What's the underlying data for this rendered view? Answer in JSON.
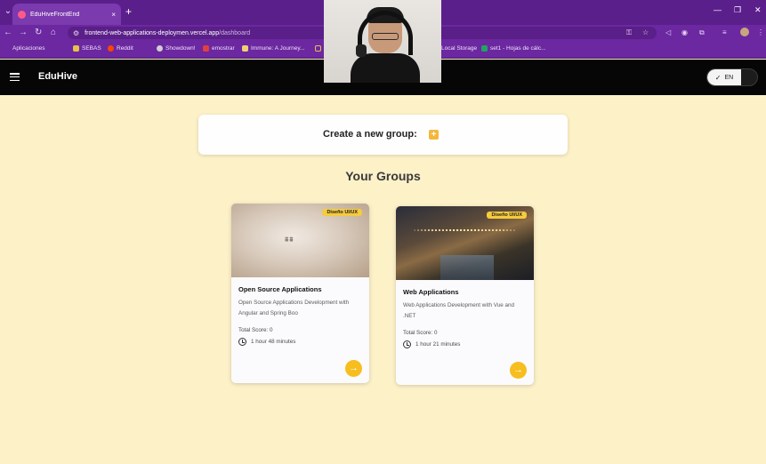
{
  "browser": {
    "tab_title": "EduHiveFrontEnd",
    "tab_close": "×",
    "new_tab": "+",
    "url_host": "frontend-web-applications-deploymen.vercel.app",
    "url_path": "/dashboard",
    "bookmarks": [
      {
        "label": "Aplicaciones",
        "color": "#7a7a7a"
      },
      {
        "label": "SEBAS",
        "color": "#e8c24a"
      },
      {
        "label": "Reddit",
        "color": "#ff4500"
      },
      {
        "label": "Showdown!",
        "color": "#cfcfcf"
      },
      {
        "label": "emostrar",
        "color": "#e04040"
      },
      {
        "label": "Immune: A Journey...",
        "color": "#f0d070"
      },
      {
        "label": "Local Storage",
        "color": "#e8c24a"
      },
      {
        "label": "set1 - Hojas de cálc...",
        "color": "#1fa463"
      }
    ],
    "colors": {
      "tabbar": "#5b1f8c",
      "toolbar": "#6b28a0"
    }
  },
  "app": {
    "brand": "EduHive",
    "language": "EN"
  },
  "create": {
    "label": "Create a new group:",
    "button_symbol": "+"
  },
  "groups": {
    "title": "Your Groups",
    "items": [
      {
        "badge": "Diseño UI/UX",
        "title": "Open Source Applications",
        "description": "Open Source Applications Development with Angular and Spring Boo",
        "score": "Total Score: 0",
        "time": "1 hour 48 minutes"
      },
      {
        "badge": "Diseño UI/UX",
        "title": "Web Applications",
        "description": "Web Applications Development with Vue and .NET",
        "score": "Total Score: 0",
        "time": "1 hour 21 minutes"
      }
    ]
  },
  "accent_color": "#f6be1f",
  "background_color": "#fdf1c8"
}
